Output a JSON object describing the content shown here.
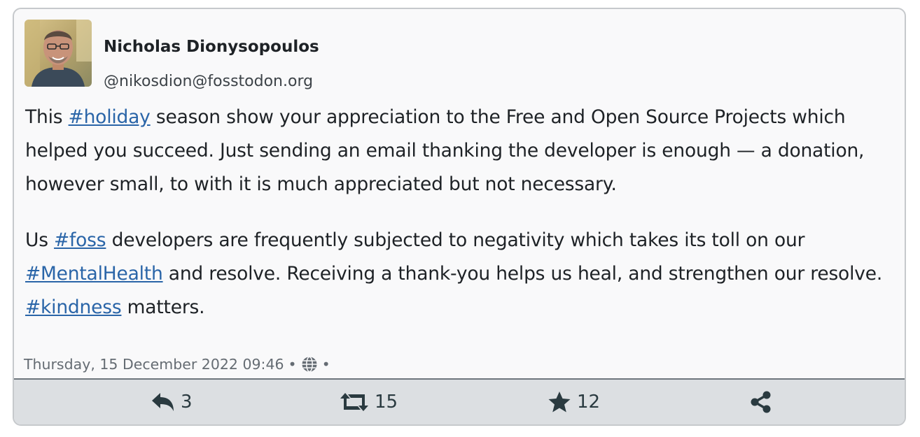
{
  "post": {
    "author_name": "Nicholas Dionysopoulos",
    "author_handle": "@nikosdion@fosstodon.org",
    "paragraph1": {
      "t1": "This ",
      "tag_holiday": "#holiday",
      "t2": " season show your appreciation to the Free and Open Source Projects which helped you succeed. Just sending an email thanking the developer is enough — a donation, however small, to with it is much appreciated but not necessary."
    },
    "paragraph2": {
      "t1": "Us ",
      "tag_foss": "#foss",
      "t2": " developers are frequently subjected to negativity which takes its toll on our ",
      "tag_mentalhealth": "#MentalHealth",
      "t3": " and resolve. Receiving a thank-you helps us heal, and strengthen our resolve. ",
      "tag_kindness": "#kindness",
      "t4": " matters."
    },
    "timestamp": "Thursday, 15 December 2022 09:46",
    "separator": "•",
    "visibility_icon": "globe-icon"
  },
  "actions": {
    "reply_count": "3",
    "boost_count": "15",
    "favourite_count": "12",
    "icons": [
      "reply-icon",
      "boost-icon",
      "star-icon",
      "share-icon"
    ]
  },
  "colors": {
    "link": "#2a65a8",
    "card_background": "#f9f9fa",
    "footer_background": "#dcdfe2",
    "icon": "#2a3a40"
  }
}
